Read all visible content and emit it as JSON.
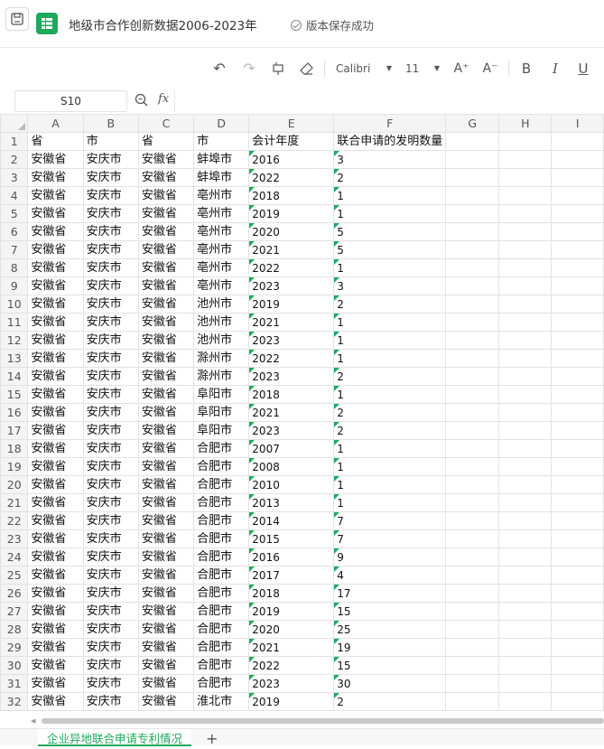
{
  "titlebar": {
    "title": "地级市合作创新数据2006-2023年",
    "save_status": "版本保存成功",
    "icons": [
      "save-icon",
      "sheet-app-icon",
      "check-circle-icon"
    ]
  },
  "toolbar": {
    "undo_icon": "↶",
    "redo_icon": "↷",
    "format_painter_icon": "⌂",
    "eraser_icon": "◇",
    "font_name": "Calibri",
    "font_size": "11",
    "font_increase": "A⁺",
    "font_decrease": "A⁻",
    "bold": "B",
    "italic": "I",
    "underline": "U"
  },
  "formula_bar": {
    "cell_ref": "S10",
    "fx": "fx",
    "value": ""
  },
  "sheet": {
    "columns": [
      "A",
      "B",
      "C",
      "D",
      "E",
      "F",
      "G",
      "H",
      "I"
    ],
    "header_row": [
      "省",
      "市",
      "省",
      "市",
      "会计年度",
      "联合申请的发明数量",
      "",
      "",
      ""
    ],
    "rows": [
      [
        "安徽省",
        "安庆市",
        "安徽省",
        "蚌埠市",
        "2016",
        "3"
      ],
      [
        "安徽省",
        "安庆市",
        "安徽省",
        "蚌埠市",
        "2022",
        "2"
      ],
      [
        "安徽省",
        "安庆市",
        "安徽省",
        "亳州市",
        "2018",
        "1"
      ],
      [
        "安徽省",
        "安庆市",
        "安徽省",
        "亳州市",
        "2019",
        "1"
      ],
      [
        "安徽省",
        "安庆市",
        "安徽省",
        "亳州市",
        "2020",
        "5"
      ],
      [
        "安徽省",
        "安庆市",
        "安徽省",
        "亳州市",
        "2021",
        "5"
      ],
      [
        "安徽省",
        "安庆市",
        "安徽省",
        "亳州市",
        "2022",
        "1"
      ],
      [
        "安徽省",
        "安庆市",
        "安徽省",
        "亳州市",
        "2023",
        "3"
      ],
      [
        "安徽省",
        "安庆市",
        "安徽省",
        "池州市",
        "2019",
        "2"
      ],
      [
        "安徽省",
        "安庆市",
        "安徽省",
        "池州市",
        "2021",
        "1"
      ],
      [
        "安徽省",
        "安庆市",
        "安徽省",
        "池州市",
        "2023",
        "1"
      ],
      [
        "安徽省",
        "安庆市",
        "安徽省",
        "滁州市",
        "2022",
        "1"
      ],
      [
        "安徽省",
        "安庆市",
        "安徽省",
        "滁州市",
        "2023",
        "2"
      ],
      [
        "安徽省",
        "安庆市",
        "安徽省",
        "阜阳市",
        "2018",
        "1"
      ],
      [
        "安徽省",
        "安庆市",
        "安徽省",
        "阜阳市",
        "2021",
        "2"
      ],
      [
        "安徽省",
        "安庆市",
        "安徽省",
        "阜阳市",
        "2023",
        "2"
      ],
      [
        "安徽省",
        "安庆市",
        "安徽省",
        "合肥市",
        "2007",
        "1"
      ],
      [
        "安徽省",
        "安庆市",
        "安徽省",
        "合肥市",
        "2008",
        "1"
      ],
      [
        "安徽省",
        "安庆市",
        "安徽省",
        "合肥市",
        "2010",
        "1"
      ],
      [
        "安徽省",
        "安庆市",
        "安徽省",
        "合肥市",
        "2013",
        "1"
      ],
      [
        "安徽省",
        "安庆市",
        "安徽省",
        "合肥市",
        "2014",
        "7"
      ],
      [
        "安徽省",
        "安庆市",
        "安徽省",
        "合肥市",
        "2015",
        "7"
      ],
      [
        "安徽省",
        "安庆市",
        "安徽省",
        "合肥市",
        "2016",
        "9"
      ],
      [
        "安徽省",
        "安庆市",
        "安徽省",
        "合肥市",
        "2017",
        "4"
      ],
      [
        "安徽省",
        "安庆市",
        "安徽省",
        "合肥市",
        "2018",
        "17"
      ],
      [
        "安徽省",
        "安庆市",
        "安徽省",
        "合肥市",
        "2019",
        "15"
      ],
      [
        "安徽省",
        "安庆市",
        "安徽省",
        "合肥市",
        "2020",
        "25"
      ],
      [
        "安徽省",
        "安庆市",
        "安徽省",
        "合肥市",
        "2021",
        "19"
      ],
      [
        "安徽省",
        "安庆市",
        "安徽省",
        "合肥市",
        "2022",
        "15"
      ],
      [
        "安徽省",
        "安庆市",
        "安徽省",
        "合肥市",
        "2023",
        "30"
      ],
      [
        "安徽省",
        "安庆市",
        "安徽省",
        "淮北市",
        "2019",
        "2"
      ]
    ]
  },
  "tabs": {
    "active_label": "企业异地联合申请专利情况",
    "add_icon": "+"
  },
  "colors": {
    "accent": "#1fa95c",
    "grid_line": "#e2e2e2",
    "header_bg": "#f4f4f4"
  }
}
